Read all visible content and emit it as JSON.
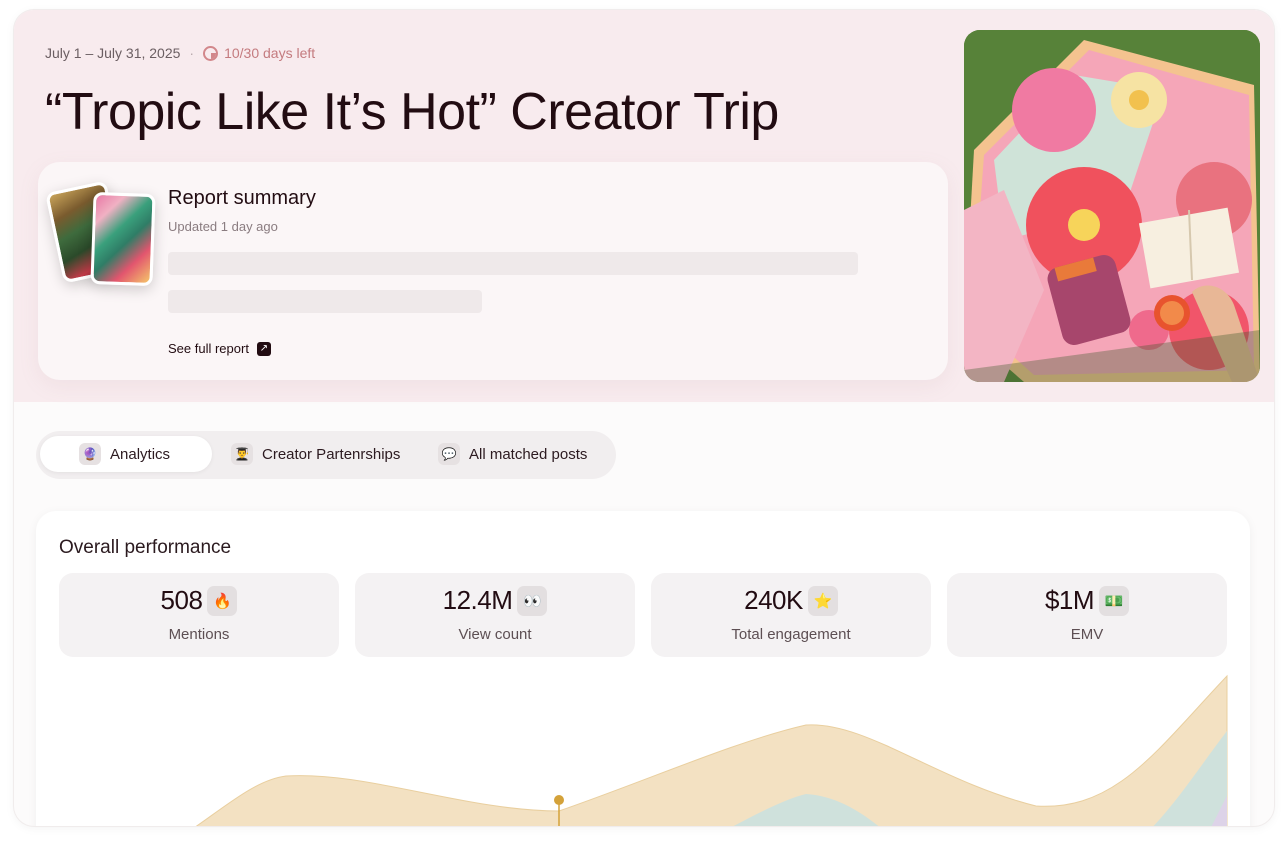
{
  "header": {
    "date_range": "July 1 – July 31, 2025",
    "separator": "·",
    "days_left": "10/30 days left",
    "title": "“Tropic Like It’s Hot” Creator Trip"
  },
  "summary": {
    "title": "Report summary",
    "updated": "Updated 1 day ago",
    "link_label": "See full report",
    "link_icon": "arrow-up-right-icon"
  },
  "tabs": [
    {
      "label": "Analytics",
      "icon": "crystal-ball-icon",
      "active": true
    },
    {
      "label": "Creator Partenrships",
      "icon": "student-icon",
      "active": false
    },
    {
      "label": "All matched posts",
      "icon": "speech-bubble-icon",
      "active": false
    }
  ],
  "performance": {
    "title": "Overall performance",
    "stats": [
      {
        "value": "508",
        "label": "Mentions",
        "emoji": "🔥",
        "icon": "fire-icon"
      },
      {
        "value": "12.4M",
        "label": "View count",
        "emoji": "👀",
        "icon": "eyes-icon"
      },
      {
        "value": "240K",
        "label": "Total engagement",
        "emoji": "⭐",
        "icon": "star-icon"
      },
      {
        "value": "$1M",
        "label": "EMV",
        "emoji": "💵",
        "icon": "money-icon"
      }
    ]
  },
  "colors": {
    "hero_bg": "#f8ebee",
    "accent_warning": "#c47b7f",
    "series_1": "#f3e1c2",
    "series_2": "#cfe1dc",
    "series_3": "#ddd3e8",
    "marker": "#d4a23a"
  }
}
